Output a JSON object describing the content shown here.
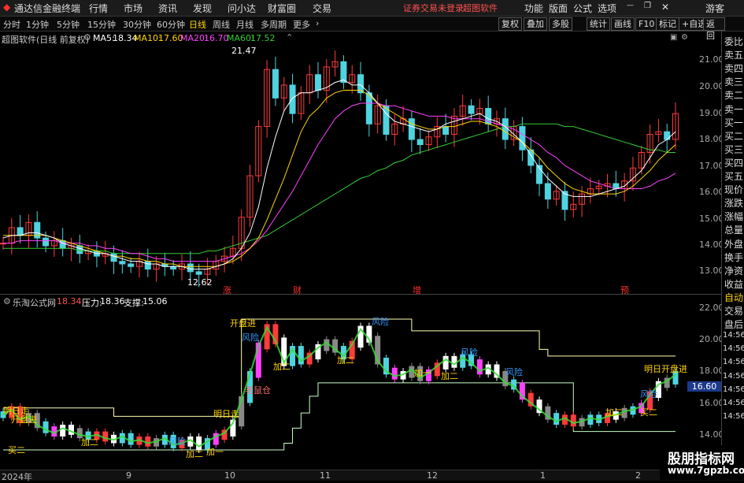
{
  "menubar": {
    "app_title": "通达信金融终端",
    "items": [
      "行情",
      "市场",
      "资讯",
      "发现",
      "问小达",
      "财富圈",
      "交易"
    ],
    "notice": "证券交易未登录",
    "software": "超图软件",
    "right_items": [
      "功能",
      "版面",
      "公式",
      "选项"
    ],
    "guest": "游客"
  },
  "toolbar": {
    "periods": [
      "分时",
      "1分钟",
      "5分钟",
      "15分钟",
      "30分钟",
      "60分钟",
      "日线",
      "周线",
      "月线",
      "多周期",
      "更多"
    ],
    "selected": "日线",
    "right_buttons": [
      "复权",
      "叠加",
      "多股",
      "统计",
      "画线",
      "F10",
      "标记",
      "+自选",
      "返回"
    ]
  },
  "main_chart": {
    "title": "超图软件(日线 前复权)",
    "ma": [
      {
        "label": "MA5:",
        "value": "18.34",
        "color": "#ffffff"
      },
      {
        "label": "MA10:",
        "value": "17.60",
        "color": "#ffd400"
      },
      {
        "label": "MA20:",
        "value": "16.70",
        "color": "#ff40ff"
      },
      {
        "label": "MA60:",
        "value": "17.52",
        "color": "#33cc33"
      }
    ],
    "high_label": "21.47",
    "low_label": "12.62",
    "y_ticks": [
      "21.00",
      "20.00",
      "19.00",
      "18.00",
      "17.00",
      "16.00",
      "15.00",
      "14.00",
      "13.00"
    ],
    "event_marks": [
      "涨",
      "财",
      "增",
      "预"
    ]
  },
  "indicator": {
    "name": "乐淘公式网",
    "value": "18.34",
    "pressure_label": "压力:",
    "pressure": "18.36",
    "support_label": "支撑:",
    "support": "15.06",
    "y_ticks": [
      "22.00",
      "20.00",
      "18.00",
      "16.00",
      "14.00"
    ],
    "current": "16.60",
    "signals": [
      "明日走",
      "开盘进",
      "买二",
      "加二",
      "风险",
      "加二",
      "加一",
      "明日走",
      "开盘进",
      "风险",
      "老鼠仓",
      "加二",
      "加二",
      "风险",
      "风险",
      "风险",
      "加二",
      "加一",
      "加二",
      "买二",
      "风险",
      "明日开盘进"
    ]
  },
  "right_panel": [
    "委比",
    "卖五",
    "卖四",
    "卖三",
    "卖二",
    "卖一",
    "买一",
    "买二",
    "买三",
    "买四",
    "买五",
    "现价",
    "涨跌",
    "涨幅",
    "总量",
    "外盘",
    "换手",
    "净资",
    "收益",
    "自动",
    "交易",
    "盘后",
    "14:56",
    "14:56",
    "14:56",
    "14:56",
    "14:56",
    "14:56",
    "14:56"
  ],
  "statusbar": {
    "dates": [
      "2024年",
      "9",
      "10",
      "11",
      "12",
      "1",
      "2"
    ]
  },
  "watermark": {
    "line1": "股朋指标网",
    "line2": "www.7gpzb.com"
  },
  "chart_data": {
    "type": "candlestick",
    "title": "超图软件(日线 前复权)",
    "ylim": [
      12.5,
      21.8
    ],
    "close": [
      14.0,
      14.6,
      14.3,
      14.8,
      14.2,
      13.9,
      14.1,
      13.8,
      13.9,
      13.6,
      13.7,
      13.5,
      13.6,
      13.3,
      13.2,
      13.1,
      13.3,
      13.0,
      13.2,
      13.1,
      13.0,
      13.2,
      12.9,
      12.8,
      13.0,
      13.3,
      13.5,
      13.8,
      15.0,
      16.6,
      18.5,
      20.7,
      19.6,
      20.1,
      19.0,
      19.8,
      20.5,
      19.9,
      20.8,
      21.0,
      20.2,
      20.5,
      19.8,
      18.6,
      19.3,
      18.2,
      18.6,
      18.8,
      18.0,
      17.8,
      18.1,
      18.5,
      18.2,
      18.9,
      19.3,
      19.0,
      19.2,
      18.6,
      18.8,
      18.0,
      18.5,
      17.6,
      17.0,
      16.3,
      15.7,
      16.0,
      15.3,
      15.5,
      15.9,
      16.1,
      16.2,
      16.3,
      16.1,
      16.4,
      16.9,
      17.5,
      18.2,
      18.3,
      18.0,
      19.0
    ],
    "ma5": [
      14.2,
      14.3,
      14.3,
      14.4,
      14.4,
      14.3,
      14.2,
      14.0,
      13.9,
      13.8,
      13.7,
      13.6,
      13.6,
      13.5,
      13.4,
      13.3,
      13.3,
      13.2,
      13.2,
      13.1,
      13.1,
      13.1,
      13.0,
      13.0,
      13.0,
      13.1,
      13.2,
      13.4,
      13.8,
      14.4,
      15.4,
      16.9,
      18.1,
      19.1,
      19.6,
      19.8,
      19.8,
      19.9,
      20.0,
      20.2,
      20.3,
      20.1,
      20.1,
      19.8,
      19.4,
      19.0,
      18.7,
      18.6,
      18.5,
      18.4,
      18.3,
      18.4,
      18.6,
      18.7,
      18.8,
      18.9,
      19.0,
      18.8,
      18.7,
      18.5,
      18.2,
      17.9,
      17.4,
      16.9,
      16.5,
      16.2,
      15.9,
      15.8,
      15.8,
      15.8,
      15.9,
      16.0,
      16.1,
      16.2,
      16.5,
      16.8,
      17.3,
      17.8,
      18.0,
      18.3
    ],
    "ma10": [
      14.3,
      14.3,
      14.3,
      14.3,
      14.3,
      14.3,
      14.2,
      14.1,
      14.0,
      13.9,
      13.8,
      13.7,
      13.6,
      13.5,
      13.5,
      13.4,
      13.4,
      13.3,
      13.3,
      13.2,
      13.2,
      13.1,
      13.1,
      13.1,
      13.1,
      13.1,
      13.2,
      13.3,
      13.5,
      13.8,
      14.2,
      14.9,
      15.7,
      16.5,
      17.4,
      18.3,
      18.9,
      19.2,
      19.6,
      19.8,
      19.9,
      19.9,
      19.9,
      19.7,
      19.4,
      19.2,
      19.0,
      18.8,
      18.6,
      18.5,
      18.4,
      18.4,
      18.5,
      18.5,
      18.6,
      18.7,
      18.7,
      18.6,
      18.5,
      18.3,
      18.1,
      17.9,
      17.6,
      17.3,
      16.9,
      16.6,
      16.3,
      16.1,
      16.0,
      15.9,
      15.9,
      15.9,
      15.9,
      16.0,
      16.2,
      16.5,
      16.8,
      17.2,
      17.5,
      17.8
    ],
    "ma20": [
      14.0,
      14.0,
      14.1,
      14.1,
      14.1,
      14.1,
      14.1,
      14.0,
      14.0,
      14.0,
      13.9,
      13.9,
      13.8,
      13.8,
      13.7,
      13.6,
      13.6,
      13.5,
      13.4,
      13.4,
      13.3,
      13.3,
      13.3,
      13.3,
      13.3,
      13.3,
      13.4,
      13.5,
      13.6,
      13.8,
      14.1,
      14.5,
      15.0,
      15.5,
      16.0,
      16.6,
      17.2,
      17.8,
      18.3,
      18.8,
      19.1,
      19.3,
      19.4,
      19.4,
      19.4,
      19.3,
      19.3,
      19.2,
      19.1,
      19.0,
      18.9,
      18.9,
      18.9,
      18.8,
      18.8,
      18.8,
      18.8,
      18.7,
      18.6,
      18.5,
      18.4,
      18.2,
      18.0,
      17.8,
      17.5,
      17.3,
      17.0,
      16.8,
      16.6,
      16.4,
      16.3,
      16.2,
      16.1,
      16.1,
      16.1,
      16.1,
      16.2,
      16.4,
      16.5,
      16.7
    ],
    "ma60": [
      13.8,
      13.8,
      13.8,
      13.8,
      13.8,
      13.8,
      13.8,
      13.8,
      13.8,
      13.7,
      13.7,
      13.7,
      13.7,
      13.6,
      13.6,
      13.6,
      13.6,
      13.6,
      13.6,
      13.6,
      13.6,
      13.6,
      13.6,
      13.6,
      13.7,
      13.7,
      13.8,
      13.9,
      14.0,
      14.1,
      14.2,
      14.3,
      14.5,
      14.7,
      14.9,
      15.1,
      15.3,
      15.5,
      15.7,
      15.9,
      16.1,
      16.3,
      16.5,
      16.6,
      16.8,
      16.9,
      17.1,
      17.2,
      17.4,
      17.5,
      17.6,
      17.7,
      17.8,
      17.9,
      18.0,
      18.1,
      18.2,
      18.3,
      18.4,
      18.5,
      18.5,
      18.6,
      18.6,
      18.6,
      18.6,
      18.6,
      18.5,
      18.5,
      18.4,
      18.3,
      18.2,
      18.1,
      18.0,
      17.9,
      17.8,
      17.7,
      17.6,
      17.6,
      17.5,
      17.5
    ],
    "indicator_close": [
      16.1,
      16.4,
      15.8,
      16.0,
      15.5,
      15.2,
      15.0,
      15.3,
      15.1,
      14.9,
      14.8,
      14.9,
      14.7,
      14.6,
      14.8,
      14.5,
      14.6,
      14.4,
      14.5,
      14.7,
      14.3,
      14.4,
      14.6,
      14.2,
      14.5,
      14.8,
      15.0,
      15.6,
      17.0,
      18.5,
      20.2,
      21.3,
      20.5,
      19.2,
      20.0,
      19.3,
      19.6,
      20.1,
      20.4,
      20.0,
      19.6,
      20.3,
      21.2,
      20.6,
      19.3,
      18.7,
      18.4,
      18.5,
      18.8,
      18.3,
      18.6,
      19.0,
      19.4,
      19.1,
      19.5,
      19.2,
      18.7,
      18.9,
      18.5,
      18.0,
      17.8,
      17.2,
      16.8,
      16.4,
      16.0,
      15.7,
      15.9,
      15.6,
      15.7,
      15.9,
      15.8,
      16.0,
      16.1,
      16.3,
      16.4,
      16.6,
      17.3,
      17.9,
      18.1,
      18.5
    ],
    "pressure": [
      16.5,
      16.5,
      16.5,
      16.5,
      16.5,
      16.5,
      16.5,
      16.5,
      16.5,
      16.5,
      16.5,
      16.5,
      16.5,
      16.0,
      16.0,
      16.0,
      16.0,
      16.0,
      16.0,
      16.0,
      16.0,
      16.0,
      16.0,
      16.0,
      16.0,
      16.0,
      16.0,
      16.0,
      21.8,
      21.8,
      21.8,
      21.8,
      21.8,
      21.8,
      21.8,
      21.8,
      21.8,
      21.8,
      21.8,
      21.8,
      21.8,
      21.8,
      21.8,
      21.8,
      21.8,
      21.8,
      21.8,
      21.8,
      21.1,
      21.1,
      21.1,
      21.1,
      21.1,
      21.1,
      21.1,
      21.1,
      21.1,
      21.1,
      21.1,
      21.1,
      21.1,
      21.1,
      21.1,
      20.0,
      19.6,
      19.6,
      19.6,
      19.6,
      19.6,
      19.6,
      19.6,
      19.6,
      19.6,
      19.6,
      19.6,
      19.6,
      19.6,
      19.6,
      19.6,
      19.6
    ],
    "support": [
      14.0,
      14.0,
      14.0,
      14.0,
      14.0,
      14.0,
      14.0,
      14.0,
      14.0,
      14.0,
      14.0,
      14.0,
      14.0,
      14.0,
      14.0,
      14.0,
      14.0,
      14.0,
      14.0,
      14.0,
      14.0,
      14.0,
      14.0,
      14.0,
      14.0,
      14.0,
      14.0,
      14.0,
      14.0,
      14.0,
      14.0,
      14.0,
      14.0,
      14.4,
      15.3,
      16.2,
      17.2,
      18.0,
      18.0,
      18.0,
      18.0,
      18.0,
      18.0,
      18.0,
      18.0,
      18.0,
      18.0,
      18.0,
      18.0,
      18.0,
      18.0,
      18.0,
      18.0,
      18.0,
      18.0,
      18.0,
      18.0,
      18.0,
      18.0,
      18.0,
      18.0,
      18.0,
      18.0,
      18.0,
      18.0,
      18.0,
      18.0,
      15.1,
      15.1,
      15.1,
      15.1,
      15.1,
      15.1,
      15.1,
      15.1,
      15.1,
      15.1,
      15.1,
      15.1,
      15.1
    ]
  }
}
